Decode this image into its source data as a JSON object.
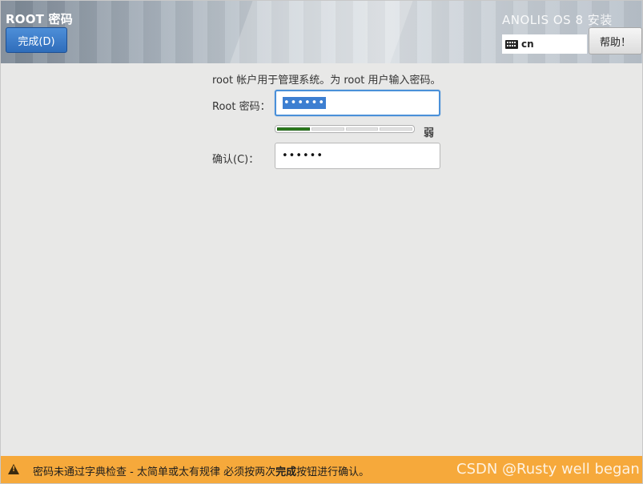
{
  "header": {
    "title": "ROOT 密码",
    "done_label": "完成(D)",
    "product_title": "ANOLIS OS 8 安装",
    "keyboard_layout": "cn",
    "help_label": "帮助！"
  },
  "form": {
    "intro": "root 帐户用于管理系统。为 root 用户输入密码。",
    "root_password_label": "Root 密码：",
    "root_password_value": "••••••",
    "confirm_label": "确认(C)：",
    "confirm_value": "••••••",
    "strength": {
      "level": 0.25,
      "label": "弱"
    }
  },
  "warning": {
    "text_before": "密码未通过字典检查 - 太简单或太有规律 必须按两次",
    "text_bold": "完成",
    "text_after": "按钮进行确认。",
    "icon": "warning-triangle-icon",
    "color": "#f6a93b"
  },
  "watermark": "CSDN @Rusty well began",
  "colors": {
    "accent": "#3d7fd1",
    "strength_fill": "#2e7d1e",
    "warning_bg": "#f6a93b"
  }
}
